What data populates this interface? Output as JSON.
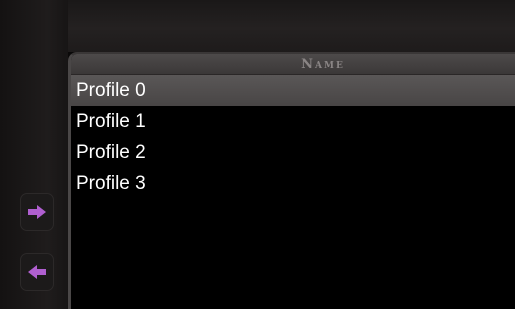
{
  "list": {
    "header_label": "Name",
    "items": [
      {
        "label": "Profile 0",
        "selected": true
      },
      {
        "label": "Profile 1",
        "selected": false
      },
      {
        "label": "Profile 2",
        "selected": false
      },
      {
        "label": "Profile 3",
        "selected": false
      }
    ]
  },
  "nav": {
    "next_icon": "arrow-right-icon",
    "prev_icon": "arrow-left-icon",
    "icon_color": "#b05fd0"
  },
  "colors": {
    "background": "#0a0909",
    "header": "#454242",
    "selected_row": "#525050",
    "text": "#ffffff"
  }
}
